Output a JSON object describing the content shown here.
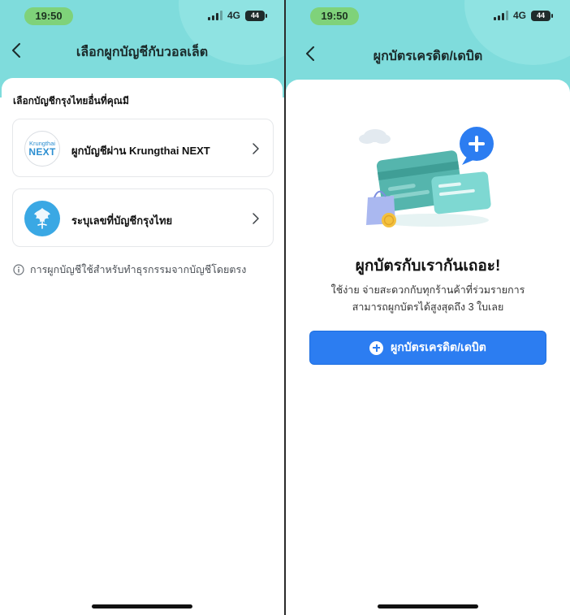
{
  "status_bar": {
    "time": "19:50",
    "network": "4G",
    "battery": "44"
  },
  "left_screen": {
    "title": "เลือกผูกบัญชีกับวอลเล็ต",
    "section_title": "เลือกบัญชีกรุงไทยอื่นที่คุณมี",
    "options": [
      {
        "label": "ผูกบัญชีผ่าน Krungthai NEXT",
        "logo_text_top": "Krungthai",
        "logo_text_main": "NEXT",
        "icon": "krungthai-next-logo"
      },
      {
        "label": "ระบุเลขที่บัญชีกรุงไทย",
        "icon": "krungthai-bank-logo"
      }
    ],
    "info_text": "การผูกบัญชีใช้สำหรับทำธุรกรรมจากบัญชีโดยตรง"
  },
  "right_screen": {
    "title": "ผูกบัตรเครดิต/เดบิต",
    "promo_title": "ผูกบัตรกับเรากันเถอะ!",
    "promo_desc_1": "ใช้ง่าย จ่ายสะดวกกับทุกร้านค้าที่ร่วมรายการ",
    "promo_desc_2": "สามารถผูกบัตรได้สูงสุดถึง 3 ใบเลย",
    "cta_label": "ผูกบัตรเครดิต/เดบิต"
  },
  "colors": {
    "header_bg": "#7fdcdc",
    "accent_blue": "#2c7df1",
    "time_pill": "#7fd27a"
  }
}
